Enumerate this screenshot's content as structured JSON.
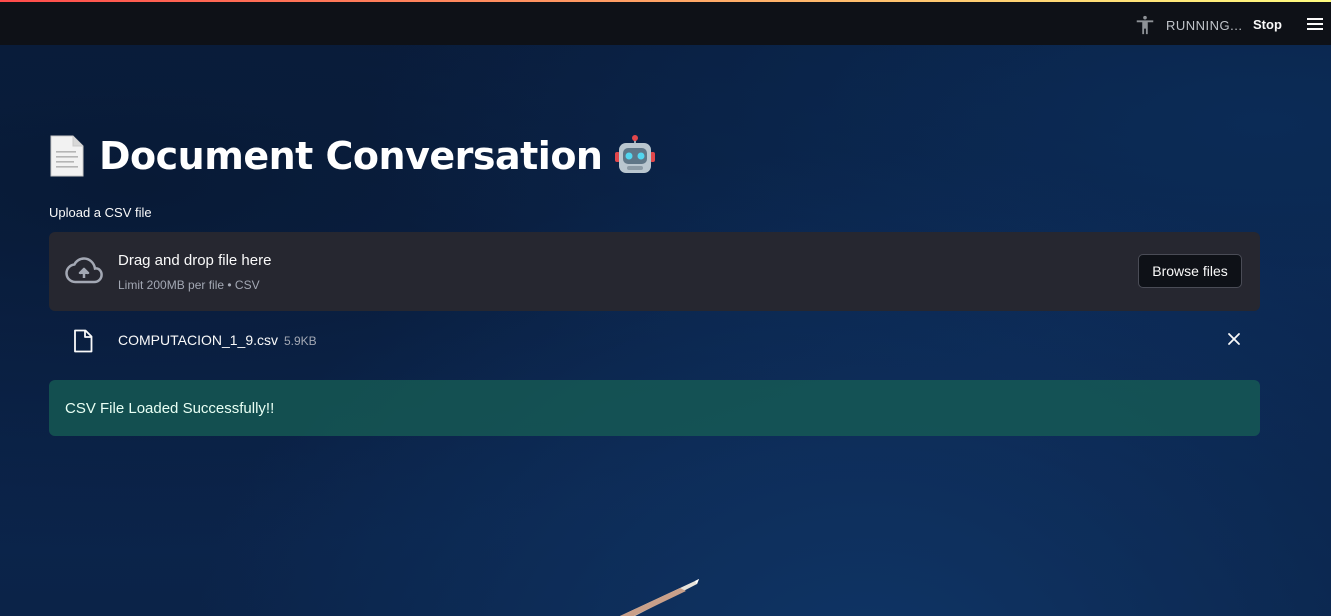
{
  "header": {
    "status": "RUNNING...",
    "stop_label": "Stop",
    "icons": [
      "accessibility-icon",
      "hamburger-menu-icon"
    ]
  },
  "page": {
    "title": "Document Conversation",
    "title_leading_icon": "page-facing-up-emoji",
    "title_trailing_icon": "robot-face-emoji"
  },
  "uploader": {
    "label": "Upload a CSV file",
    "drop_title": "Drag and drop file here",
    "drop_subtitle": "Limit 200MB per file • CSV",
    "browse_label": "Browse files",
    "icon": "cloud-upload-icon"
  },
  "uploaded_file": {
    "name": "COMPUTACION_1_9.csv",
    "size": "5.9KB",
    "icon": "file-icon"
  },
  "alert": {
    "message": "CSV File Loaded Successfully!!",
    "type": "success"
  },
  "colors": {
    "header_bg": "#0e1117",
    "dropzone_bg": "#262730",
    "success_bg": "#175f54",
    "accent_line_start": "#ff4b4b",
    "accent_line_end": "#fffd80"
  }
}
